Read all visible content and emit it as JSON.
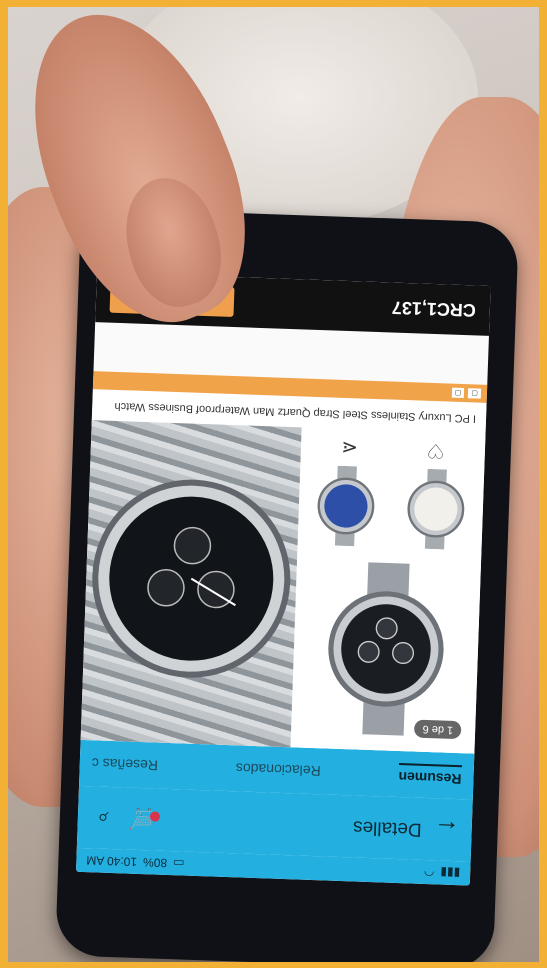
{
  "status_bar": {
    "time": "10:40 AM",
    "battery": "80%",
    "icons": [
      "signal-icon",
      "wifi-icon",
      "battery-icon"
    ]
  },
  "toolbar": {
    "back_icon": "back-arrow-icon",
    "title": "Detalles",
    "cart_icon": "cart-icon",
    "search_icon": "search-icon"
  },
  "tabs": [
    {
      "label": "Resumen",
      "active": true
    },
    {
      "label": "Relacionados",
      "active": false
    },
    {
      "label": "Reseñas c",
      "active": false
    }
  ],
  "gallery": {
    "counter": "1 de 6",
    "share_icon": "share-icon",
    "wishlist_icon": "heart-icon"
  },
  "product": {
    "title": "I PC Luxury Stainless Steel Strap Quartz Man Waterproof Business Watch"
  },
  "price_bar": {
    "price": "CRC1,137"
  },
  "colors": {
    "accent": "#23b0e0",
    "price_bar": "#111111",
    "buy_button": "#f0a04d",
    "badge": "#d9334d"
  }
}
